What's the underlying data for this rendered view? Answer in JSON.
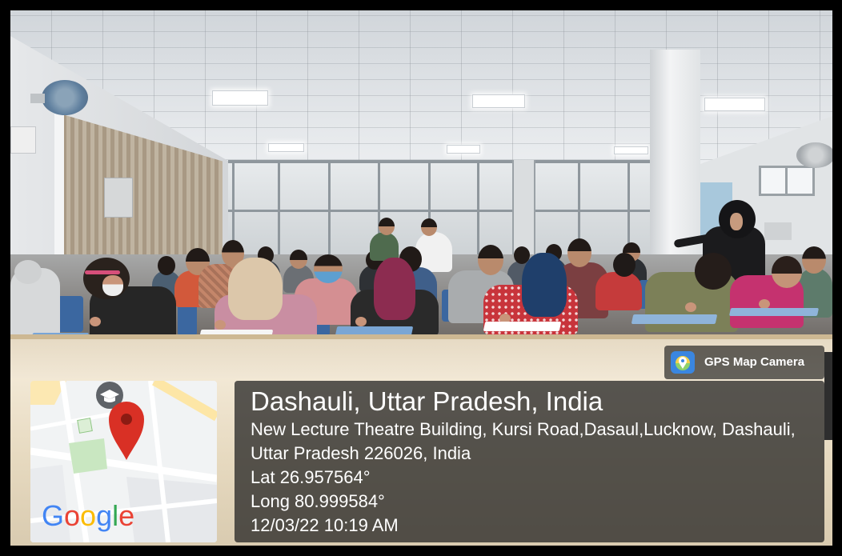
{
  "overlay": {
    "badge": {
      "label": "GPS Map Camera",
      "icon": "gps-map-camera-icon"
    },
    "location": {
      "title": "Dashauli, Uttar Pradesh, India",
      "address_line1": "New Lecture Theatre Building, Kursi Road,Dasaul,Lucknow, Dashauli,",
      "address_line2": "Uttar Pradesh 226026, India",
      "latitude": "Lat 26.957564°",
      "longitude": "Long 80.999584°",
      "datetime": "12/03/22 10:19 AM"
    },
    "map": {
      "logo": "Google",
      "logo_colors": [
        "#4285F4",
        "#EA4335",
        "#FBBC05",
        "#4285F4",
        "#34A853",
        "#EA4335"
      ],
      "pin_icon": "location-pin-icon",
      "place_icon": "graduation-cap-icon"
    }
  },
  "colors": {
    "panel_background": "#202020",
    "overlay_text": "#FFFFFF",
    "pin": "#D93025",
    "badge_icon": "#3A86E0"
  }
}
